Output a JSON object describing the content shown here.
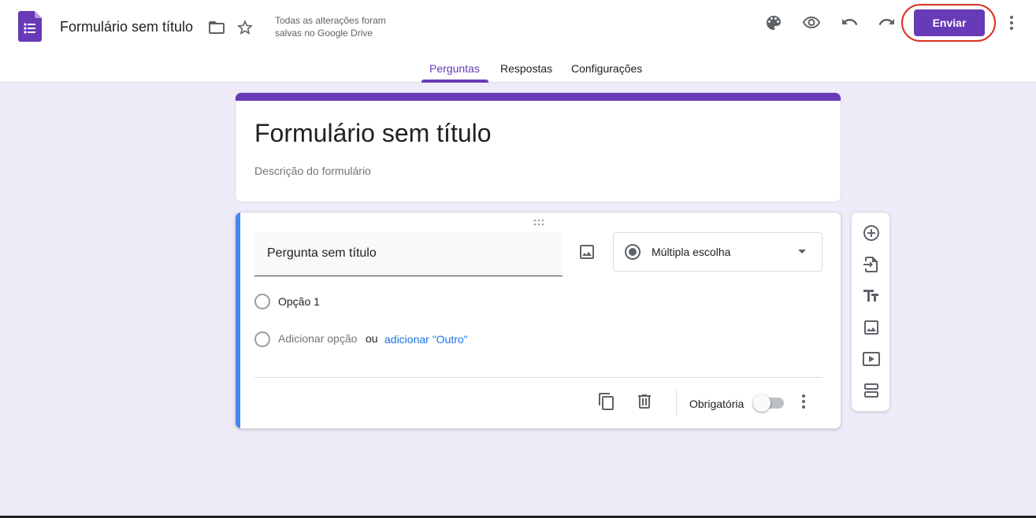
{
  "header": {
    "doc_title": "Formulário sem título",
    "save_status": "Todas as alterações foram salvas no Google Drive",
    "send_label": "Enviar"
  },
  "tabs": [
    {
      "label": "Perguntas",
      "active": true
    },
    {
      "label": "Respostas",
      "active": false
    },
    {
      "label": "Configurações",
      "active": false
    }
  ],
  "form": {
    "title": "Formulário sem título",
    "description_placeholder": "Descrição do formulário"
  },
  "question": {
    "title": "Pergunta sem título",
    "type": "Múltipla escolha",
    "options": [
      "Opção 1"
    ],
    "add_option": "Adicionar opção",
    "or_text": "ou",
    "add_other": "adicionar \"Outro\"",
    "required_label": "Obrigatória",
    "required": false
  },
  "colors": {
    "accent": "#673ab7",
    "question_bar": "#4285f4",
    "background": "#f0ebf8",
    "link": "#1a73e8",
    "highlight_ring": "#d93025"
  },
  "icons": {
    "header": [
      "forms-logo-icon",
      "folder-icon",
      "star-icon",
      "palette-icon",
      "eye-icon",
      "undo-icon",
      "redo-icon",
      "more-vert-icon"
    ],
    "side_tools": [
      "add-circle-icon",
      "import-questions-icon",
      "title-text-icon",
      "image-icon",
      "video-icon",
      "section-icon"
    ],
    "footer": [
      "duplicate-icon",
      "trash-icon",
      "more-vert-icon"
    ]
  }
}
